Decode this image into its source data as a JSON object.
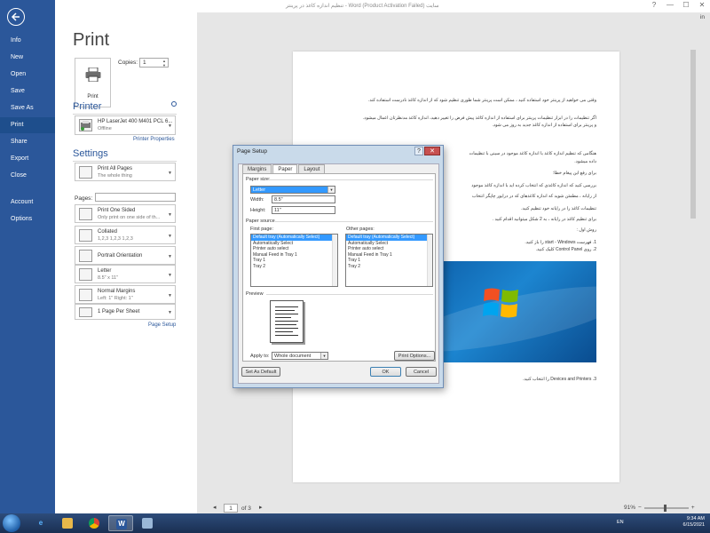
{
  "window": {
    "title": "تنظیم اندازه کاغذ در پرینتر - Word (Product Activation Failed) سایت",
    "sign_in": "Sign in",
    "controls": [
      "?",
      "—",
      "☐",
      "✕"
    ]
  },
  "nav": {
    "items": [
      "Info",
      "New",
      "Open",
      "Save",
      "Save As",
      "Print",
      "Share",
      "Export",
      "Close",
      "Account",
      "Options"
    ],
    "active": "Print"
  },
  "print": {
    "heading": "Print",
    "print_button_label": "Print",
    "copies_label": "Copies:",
    "copies_value": "1",
    "printer_heading": "Printer",
    "printer_name": "HP LaserJet 400 M401 PCL 6...",
    "printer_status": "Offline",
    "printer_properties": "Printer Properties",
    "settings_heading": "Settings",
    "settings": [
      {
        "main": "Print All Pages",
        "sub": "The whole thing"
      },
      {
        "main": "Print One Sided",
        "sub": "Only print on one side of th..."
      },
      {
        "main": "Collated",
        "sub": "1,2,3   1,2,3   1,2,3"
      },
      {
        "main": "Portrait Orientation",
        "sub": ""
      },
      {
        "main": "Letter",
        "sub": "8.5\" x 11\""
      },
      {
        "main": "Normal Margins",
        "sub": "Left: 1\"    Right: 1\""
      },
      {
        "main": "1 Page Per Sheet",
        "sub": ""
      }
    ],
    "pages_label": "Pages:",
    "pages_value": "",
    "page_setup_link": "Page Setup"
  },
  "preview": {
    "lines": [
      "وقتی می خواهید از پرینتر خود استفاده کنید ، ممکن است پرینتر شما طوری تنظیم شود که از اندازه کاغذ نادرست استفاده کند.",
      "اگر تنظیمات را در ابزار تنظیمات پرینتر برای استفاده از اندازه کاغذ پیش فرض را تغییر دهید، اندازه کاغذ مدنظرتان اعمال میشود.",
      "و پرینتر برای استفاده از اندازه کاغذ جدید به روز می شود.",
      "هنگامی که تنظیم اندازه کاغذ با اندازه کاغذ موجود در سینی با تنظیمات",
      "داده میشود.",
      "برای رفع این پیغام خطا:",
      "بررسی کنید که اندازه کاغذی که انتخاب کرده اید با اندازه کاغذ موجود",
      "از رایانه ، مطمئن شوید که اندازه کاغذهای که در درایور چاپگر انتخاب",
      "تنظیمات کاغذ را در رایانه خود تنظیم کنید.",
      "برای تنظیم کاغذ در رایانه ، به 2 شکل میتوانید اقدام کنید .",
      "روش اول :",
      "1.   فهرست start - Windows را باز کنید.",
      "2.   روی Control Panel کلیک کنید.",
      "3.   Devices and Printers را انتخاب کنید."
    ],
    "current_page": "1",
    "page_of": "of 3",
    "zoom": "91%"
  },
  "dialog": {
    "title": "Page Setup",
    "tabs": [
      "Margins",
      "Paper",
      "Layout"
    ],
    "active_tab": "Paper",
    "paper_size_label": "Paper size:",
    "paper_size_value": "Letter",
    "width_label": "Width:",
    "width_value": "8.5\"",
    "height_label": "Height:",
    "height_value": "11\"",
    "paper_source_label": "Paper source",
    "first_page_label": "First page:",
    "other_pages_label": "Other pages:",
    "trays": [
      "Default tray (Automatically Select)",
      "Automatically Select",
      "Printer auto select",
      "Manual Feed in Tray 1",
      "Tray 1",
      "Tray 2"
    ],
    "preview_label": "Preview",
    "apply_to_label": "Apply to:",
    "apply_to_value": "Whole document",
    "print_options": "Print Options...",
    "set_default": "Set As Default",
    "ok": "OK",
    "cancel": "Cancel"
  },
  "taskbar": {
    "lang": "EN",
    "time": "9:34 AM",
    "date": "6/15/2021"
  }
}
